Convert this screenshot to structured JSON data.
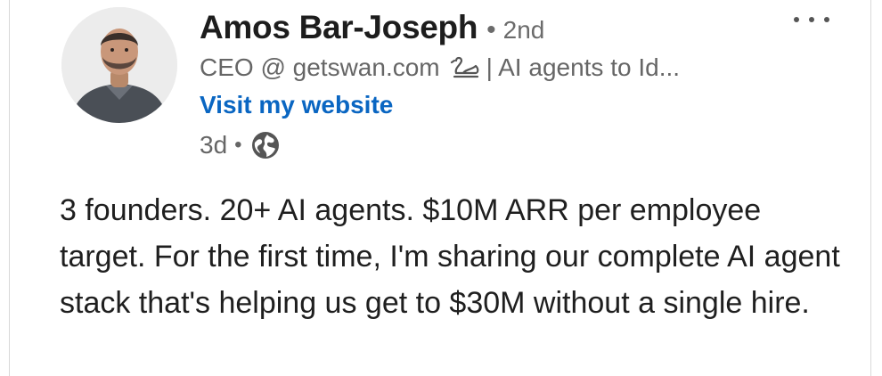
{
  "author": {
    "name": "Amos Bar-Joseph",
    "separator": "•",
    "degree": "2nd",
    "headline_part1": "CEO @ getswan.com",
    "headline_icon": "swan-icon",
    "headline_part2": "| AI agents to Id...",
    "website_link": "Visit my website",
    "avatar_icon": "profile-photo"
  },
  "post": {
    "age": "3d",
    "separator": "•",
    "visibility_icon": "globe-icon",
    "menu_icon": "more-options-icon",
    "text": "3 founders. 20+ AI agents. $10M ARR per employee target. For the first time, I'm sharing our complete AI agent stack that's helping us get to $30M without a single hire."
  },
  "colors": {
    "link": "#0a66c2",
    "name": "#1d1d1d",
    "secondary_text": "#666666"
  }
}
